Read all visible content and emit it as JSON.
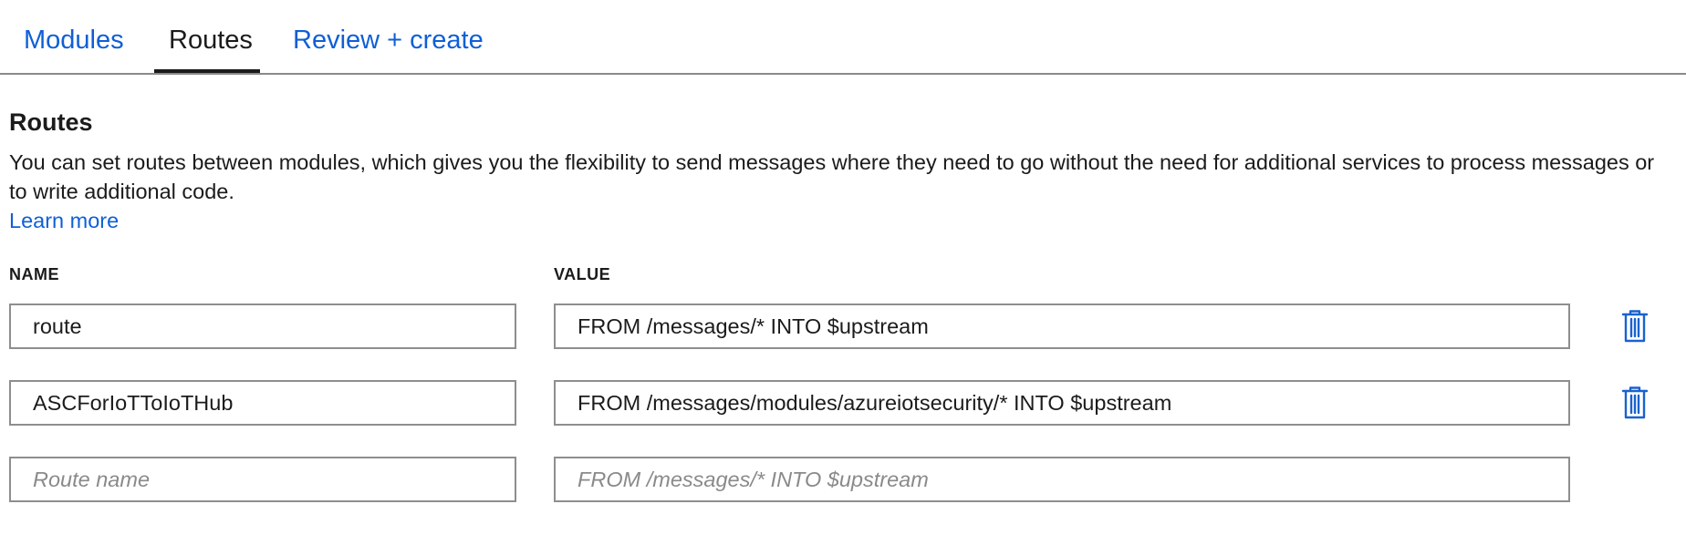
{
  "tabs": [
    {
      "label": "Modules",
      "active": false
    },
    {
      "label": "Routes",
      "active": true
    },
    {
      "label": "Review + create",
      "active": false
    }
  ],
  "section": {
    "title": "Routes",
    "description": "You can set routes between modules, which gives you the flexibility to send messages where they need to go without the need for additional services to process messages or to write additional code.",
    "learn_more": "Learn more"
  },
  "columns": {
    "name": "NAME",
    "value": "VALUE"
  },
  "routes": [
    {
      "name": "route",
      "value": "FROM /messages/* INTO $upstream"
    },
    {
      "name": "ASCForIoTToIoTHub",
      "value": "FROM /messages/modules/azureiotsecurity/* INTO $upstream"
    }
  ],
  "new_route": {
    "name_placeholder": "Route name",
    "value_placeholder": "FROM /messages/* INTO $upstream"
  },
  "icons": {
    "delete": "trash-icon"
  },
  "colors": {
    "link": "#0f5fd6",
    "border": "#8e8e8e",
    "text": "#1b1b1b"
  }
}
